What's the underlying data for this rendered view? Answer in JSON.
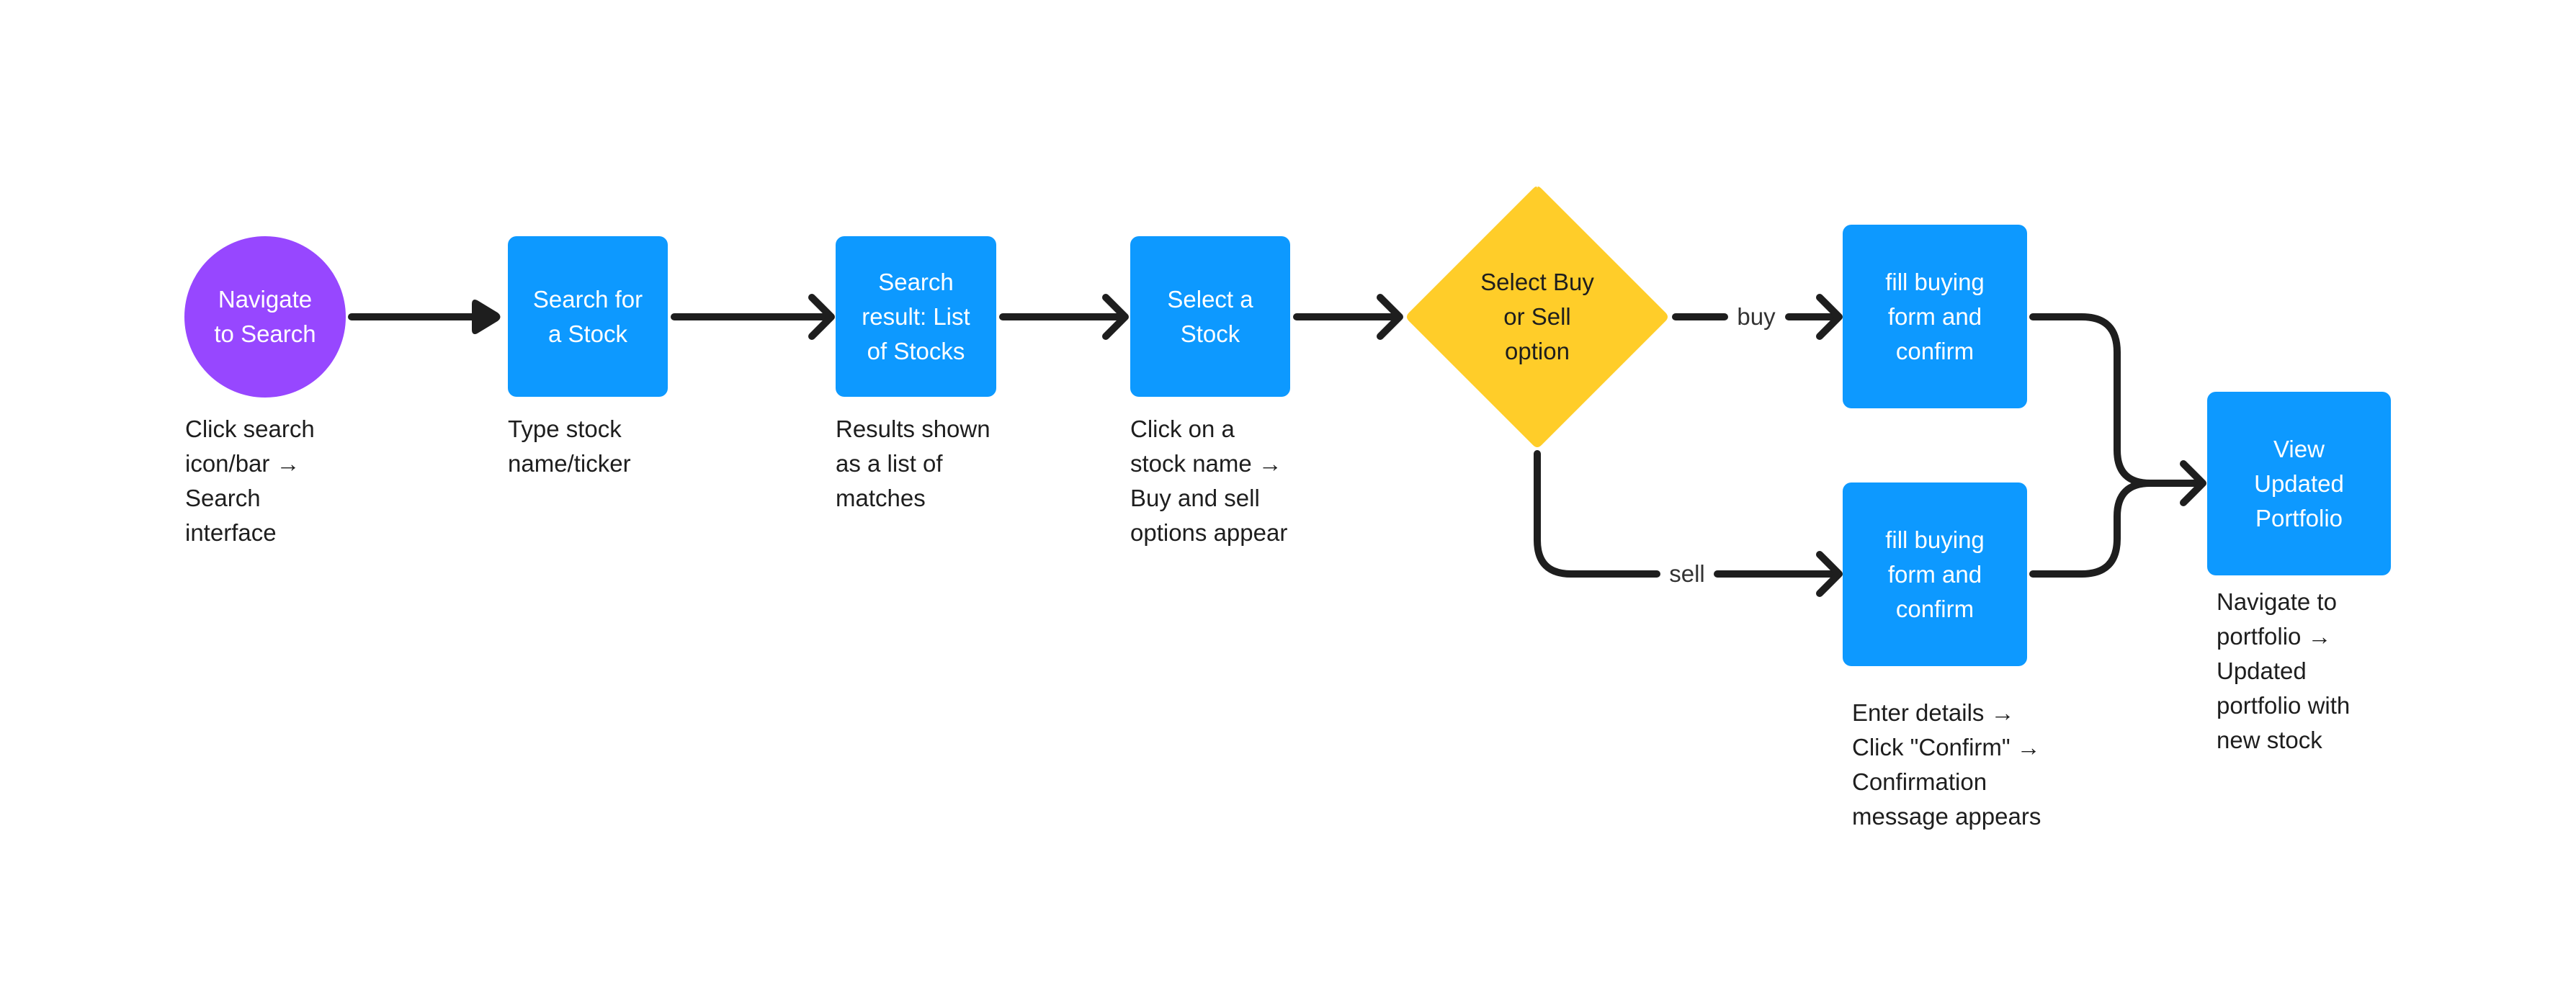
{
  "colors": {
    "start": "#9747FF",
    "process": "#0D99FF",
    "decision": "#FFCD29",
    "connector": "#1E1E1E",
    "text_light": "#FFFFFF",
    "text_dark": "#1E1E1E"
  },
  "nodes": {
    "start": {
      "label": "Navigate\nto Search",
      "caption": "Click search\nicon/bar →\nSearch\ninterface"
    },
    "search": {
      "label": "Search for\na Stock",
      "caption": "Type stock\nname/ticker"
    },
    "results": {
      "label": "Search\nresult: List\nof Stocks",
      "caption": "Results shown\nas a list of\nmatches"
    },
    "select": {
      "label": "Select a\nStock",
      "caption": "Click on a\nstock name →\nBuy and sell\noptions appear"
    },
    "decision": {
      "label": "Select Buy\nor Sell\noption"
    },
    "buy_form": {
      "label": "fill buying\nform and\nconfirm"
    },
    "sell_form": {
      "label": "fill buying\nform and\nconfirm",
      "caption": "Enter details →\nClick \"Confirm\" →\nConfirmation\nmessage appears"
    },
    "portfolio": {
      "label": "View\nUpdated\nPortfolio",
      "caption": "Navigate to\nportfolio →\nUpdated\nportfolio with\nnew stock"
    }
  },
  "edges": {
    "buy_label": "buy",
    "sell_label": "sell"
  }
}
